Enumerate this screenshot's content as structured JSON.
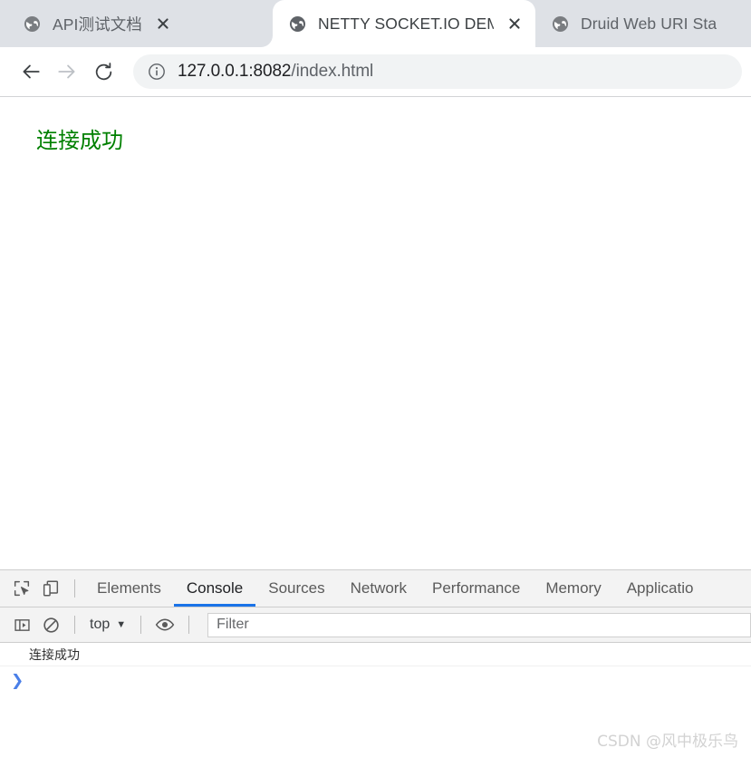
{
  "browser": {
    "tabs": [
      {
        "title": "API测试文档",
        "favicon": "globe-icon",
        "active": false,
        "close_label": "×"
      },
      {
        "title": "NETTY SOCKET.IO DEMO",
        "favicon": "globe-icon",
        "active": true,
        "close_label": "×"
      },
      {
        "title": "Druid Web URI Stat",
        "favicon": "globe-icon",
        "active": false,
        "close_label": ""
      }
    ],
    "toolbar": {
      "back_icon": "arrow-left-icon",
      "forward_icon": "arrow-right-icon",
      "reload_icon": "reload-icon",
      "site_info_icon": "info-circle-icon",
      "url_host": "127.0.0.1:8082",
      "url_path": "/index.html"
    }
  },
  "page": {
    "message": "连接成功",
    "message_color": "#008000"
  },
  "devtools": {
    "inspect_icon": "cursor-select-icon",
    "device_toolbar_icon": "device-toggle-icon",
    "tabs": [
      {
        "label": "Elements",
        "active": false
      },
      {
        "label": "Console",
        "active": true
      },
      {
        "label": "Sources",
        "active": false
      },
      {
        "label": "Network",
        "active": false
      },
      {
        "label": "Performance",
        "active": false
      },
      {
        "label": "Memory",
        "active": false
      },
      {
        "label": "Applicatio",
        "active": false
      }
    ],
    "active_tab_underline_color": "#1a73e8",
    "console_toolbar": {
      "sidebar_icon": "console-sidebar-icon",
      "clear_icon": "clear-console-icon",
      "context": "top",
      "context_caret": "▼",
      "eye_icon": "live-expression-eye-icon",
      "filter_placeholder": "Filter"
    },
    "console_messages": [
      {
        "text": "连接成功"
      }
    ],
    "prompt_chevron": "❯",
    "prompt_chevron_color": "#4a7fe8"
  },
  "watermark": {
    "text": "CSDN @风中极乐鸟"
  }
}
